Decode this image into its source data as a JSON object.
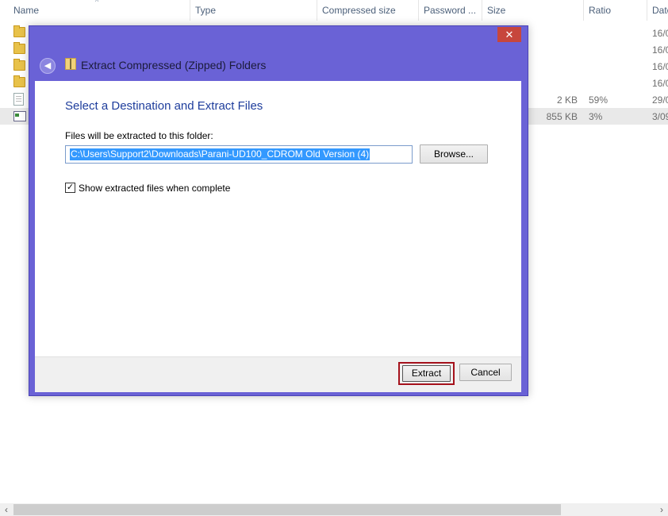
{
  "explorer": {
    "columns": [
      {
        "label": "Name"
      },
      {
        "label": "Type"
      },
      {
        "label": "Compressed size"
      },
      {
        "label": "Password ..."
      },
      {
        "label": "Size"
      },
      {
        "label": "Ratio"
      },
      {
        "label": "Date"
      }
    ],
    "sort_indicator": "^",
    "rows": [
      {
        "icon": "folder-icon",
        "size": "",
        "ratio": "",
        "date": "16/0"
      },
      {
        "icon": "folder-icon",
        "size": "",
        "ratio": "",
        "date": "16/0"
      },
      {
        "icon": "folder-icon",
        "size": "",
        "ratio": "",
        "date": "16/0"
      },
      {
        "icon": "folder-icon",
        "size": "",
        "ratio": "",
        "date": "16/0"
      },
      {
        "icon": "text-file-icon",
        "size": "2 KB",
        "ratio": "59%",
        "date": "29/0"
      },
      {
        "icon": "application-icon",
        "size": "855 KB",
        "ratio": "3%",
        "date": "3/09"
      }
    ],
    "scrollbar": {
      "left_arrow": "‹",
      "right_arrow": "›"
    }
  },
  "dialog": {
    "title": "Extract Compressed (Zipped) Folders",
    "close_glyph": "✕",
    "back_glyph": "◀",
    "heading": "Select a Destination and Extract Files",
    "folder_label": "Files will be extracted to this folder:",
    "folder_path": "C:\\Users\\Support2\\Downloads\\Parani-UD100_CDROM Old Version (4)",
    "browse_label": "Browse...",
    "show_files_label": "Show extracted files when complete",
    "show_files_checked": true,
    "check_glyph": "✓",
    "extract_label": "Extract",
    "cancel_label": "Cancel"
  },
  "colors": {
    "dialog_frame": "#6a62d6",
    "heading": "#1e3d9c",
    "selection": "#3399ff",
    "close_button": "#c7463c",
    "focus_outline": "#a5121c"
  }
}
